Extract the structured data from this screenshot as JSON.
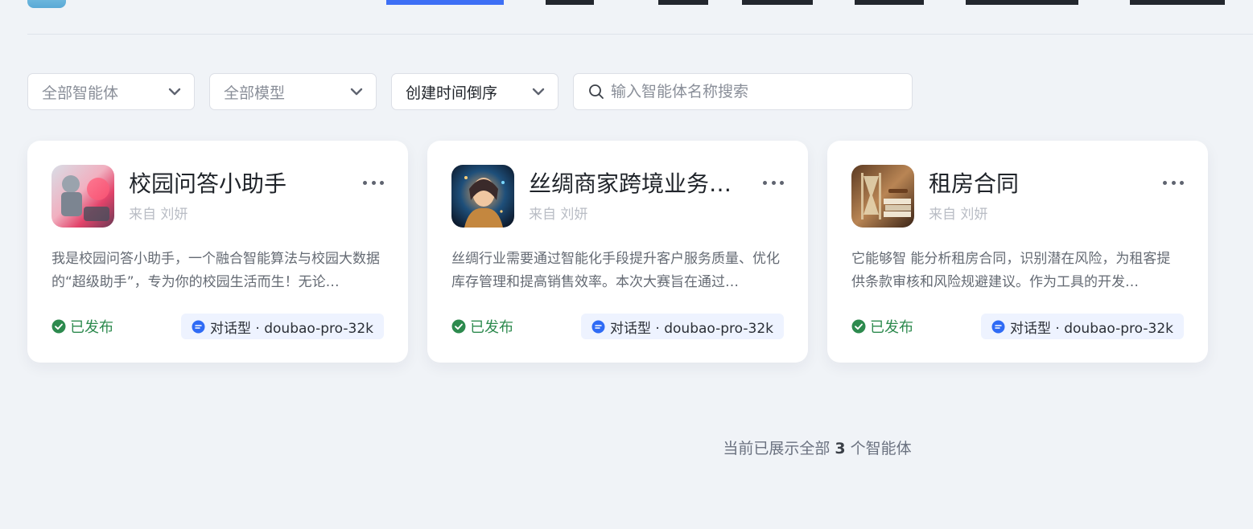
{
  "filters": {
    "agent_scope": "全部智能体",
    "model": "全部模型",
    "sort": "创建时间倒序",
    "search_placeholder": "输入智能体名称搜索"
  },
  "cards": [
    {
      "title": "校园问答小助手",
      "author": "来自 刘妍",
      "description": "我是校园问答小助手，一个融合智能算法与校园大数据的“超级助手”，专为你的校园生活而生！无论…",
      "status": "已发布",
      "tag": "对话型 · doubao-pro-32k"
    },
    {
      "title": "丝绸商家跨境业务…",
      "author": "来自 刘妍",
      "description": "丝绸行业需要通过智能化手段提升客户服务质量、优化库存管理和提高销售效率。本次大赛旨在通过…",
      "status": "已发布",
      "tag": "对话型 · doubao-pro-32k"
    },
    {
      "title": "租房合同",
      "author": "来自 刘妍",
      "description": "它能够智 能分析租房合同，识别潜在风险，为租客提供条款审核和风险规避建议。作为工具的开发…",
      "status": "已发布",
      "tag": "对话型 · doubao-pro-32k"
    }
  ],
  "footer": {
    "prefix": "当前已展示全部",
    "count": "3",
    "suffix": "个智能体"
  },
  "colors": {
    "page_bg": "#f0f3f7",
    "accent": "#3d6ff5",
    "status_green": "#2d8a4e"
  }
}
